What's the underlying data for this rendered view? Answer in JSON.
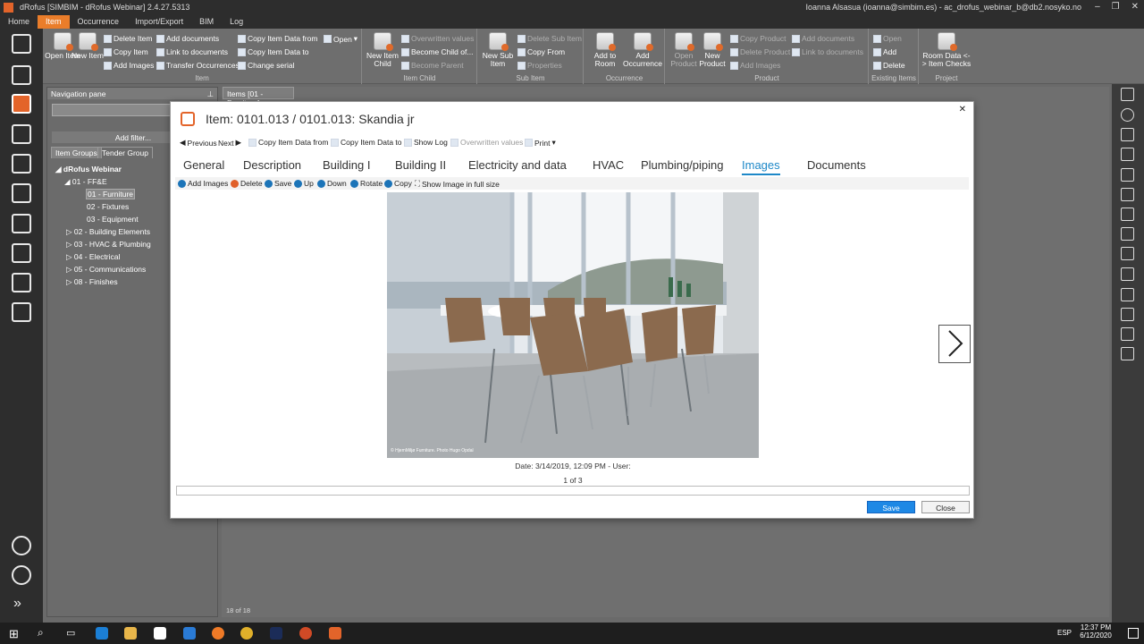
{
  "window": {
    "title": "dRofus [SIMBIM - dRofus Webinar] 2.4.27.5313",
    "user": "Ioanna Alsasua (ioanna@simbim.es) - ac_drofus_webinar_b@db2.nosyko.no"
  },
  "menu": [
    "Home",
    "Item",
    "Occurrence",
    "Import/Export",
    "BIM",
    "Log"
  ],
  "ribbon": {
    "item": {
      "label": "Item",
      "open": "Open Item",
      "new": "New Item",
      "delete": "Delete Item",
      "copy": "Copy Item",
      "add_images": "Add Images",
      "add_documents": "Add documents",
      "link_documents": "Link to documents",
      "transfer": "Transfer Occurrences",
      "copy_from": "Copy Item Data from",
      "copy_to": "Copy Item Data to",
      "change_serial": "Change serial",
      "open_menu": "Open"
    },
    "item_child": {
      "label": "Item Child",
      "new_child": "New Item Child",
      "overwritten": "Overwritten values",
      "become_child": "Become Child of...",
      "become_parent": "Become Parent"
    },
    "sub_item": {
      "label": "Sub Item",
      "new_sub": "New Sub Item",
      "delete_sub": "Delete Sub Item",
      "copy_from": "Copy From",
      "properties": "Properties"
    },
    "occurrence": {
      "label": "Occurrence",
      "add_room": "Add to Room",
      "add_occ": "Add Occurrence"
    },
    "product": {
      "label": "Product",
      "open": "Open Product",
      "new": "New Product",
      "copy": "Copy Product",
      "delete": "Delete Product",
      "add_images": "Add Images",
      "add_documents": "Add documents",
      "link_documents": "Link to documents"
    },
    "existing": {
      "label": "Existing Items",
      "open": "Open",
      "add": "Add",
      "delete": "Delete"
    },
    "project": {
      "label": "Project",
      "room_data": "Room Data <- > Item Checks"
    }
  },
  "nav": {
    "title": "Navigation pane",
    "add_filter": "Add filter...",
    "tabs": [
      "Item Groups",
      "Tender Group"
    ],
    "tree": {
      "root": "dRofus Webinar",
      "g01": "01 - FF&E",
      "g0101": "01 - Furniture",
      "g0102": "02 - Fixtures",
      "g0103": "03 - Equipment",
      "g02": "02 - Building Elements",
      "g03": "03 - HVAC & Plumbing",
      "g04": "04 - Electrical",
      "g05": "05 - Communications",
      "g08": "08 - Finishes"
    }
  },
  "work": {
    "tab": "Items [01 - Furniture]",
    "status": "18 of 18"
  },
  "dialog": {
    "title": "Item: 0101.013 / 0101.013: Skandia jr",
    "toolbar": {
      "previous": "Previous",
      "next": "Next",
      "copy_from": "Copy Item Data from",
      "copy_to": "Copy Item Data to",
      "show_log": "Show Log",
      "overwritten": "Overwritten values",
      "print": "Print"
    },
    "tabs": [
      "General",
      "Description",
      "Building I",
      "Building II",
      "Electricity and data",
      "HVAC",
      "Plumbing/piping",
      "Images",
      "Documents"
    ],
    "image_toolbar": {
      "add": "Add Images",
      "delete": "Delete",
      "save": "Save",
      "up": "Up",
      "down": "Down",
      "rotate": "Rotate",
      "copy": "Copy",
      "full": "Show Image in full size"
    },
    "photo_credit": "© HjemMiljø Furniture. Photo Hugo Opdal",
    "date": "Date: 3/14/2019, 12:09 PM - User:",
    "page": "1 of 3",
    "save": "Save",
    "close": "Close"
  },
  "taskbar": {
    "lang": "ESP",
    "time": "12:37 PM",
    "date": "6/12/2020"
  }
}
